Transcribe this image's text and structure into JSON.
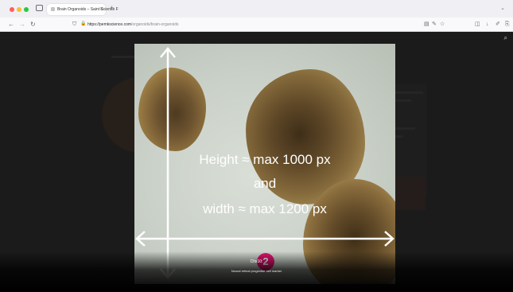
{
  "browser": {
    "tab_title": "Brain Organoids – Saint Science F",
    "tab_close": "✕",
    "new_tab": "+",
    "tab_overflow": "⌄",
    "url_host": "https://pemkscience.com",
    "url_path": "/organoids/brain-organoids",
    "nav_icons": {
      "back": "←",
      "forward": "→",
      "reload": "↻"
    },
    "toolbar_icons": {
      "shield": "⛉",
      "lock": "🔒",
      "reader": "▤",
      "translate": "✎",
      "bookmark": "☆",
      "extensions": "◫",
      "downloads": "↓",
      "tools": "✐",
      "share": "⎘"
    }
  },
  "lightbox": {
    "zoom_icon": "⌕",
    "overlay_line_1": "Height ≈ max 1000 px",
    "overlay_line_2": "and",
    "overlay_line_3": "width ≈ max 1200 px",
    "slide_number": "2",
    "caption_title": "Chx10:",
    "caption_subtitle": "Neural retinal progenitor cell marker"
  },
  "colors": {
    "badge": "#e0136f",
    "arrow": "#ffffff"
  }
}
